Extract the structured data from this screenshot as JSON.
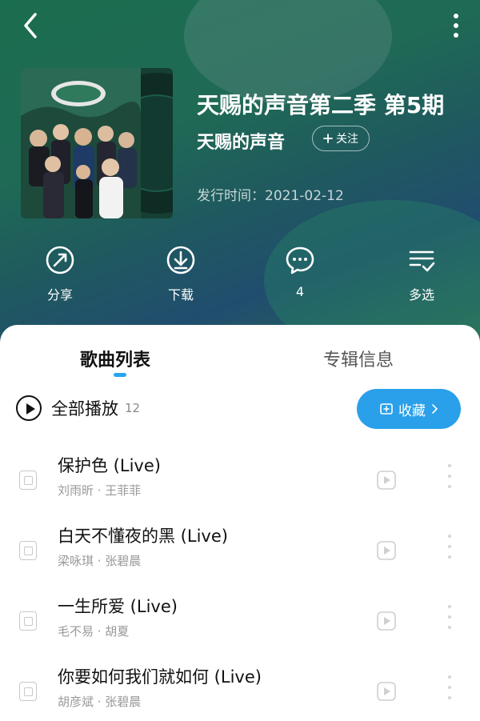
{
  "header": {
    "album_title": "天赐的声音第二季 第5期",
    "artist": "天赐的声音",
    "follow_label": "关注",
    "release_date": "发行时间：2021-02-12"
  },
  "actions": [
    {
      "label": "分享",
      "icon": "share-icon"
    },
    {
      "label": "下载",
      "icon": "download-icon"
    },
    {
      "label": "4",
      "icon": "comment-icon"
    },
    {
      "label": "多选",
      "icon": "multi-select-icon"
    }
  ],
  "tabs": {
    "songs": "歌曲列表",
    "info": "专辑信息"
  },
  "play_all": {
    "label": "全部播放",
    "count": "12"
  },
  "collect_label": "收藏",
  "songs": [
    {
      "title": "保护色 (Live)",
      "artists": "刘雨昕 · 王菲菲"
    },
    {
      "title": "白天不懂夜的黑 (Live)",
      "artists": "梁咏琪 · 张碧晨"
    },
    {
      "title": "一生所爱 (Live)",
      "artists": "毛不易 · 胡夏"
    },
    {
      "title": "你要如何我们就如何 (Live)",
      "artists": "胡彦斌 · 张碧晨"
    }
  ],
  "colors": {
    "accent": "#2aa0ea",
    "header_bg": "#1f6a55"
  }
}
